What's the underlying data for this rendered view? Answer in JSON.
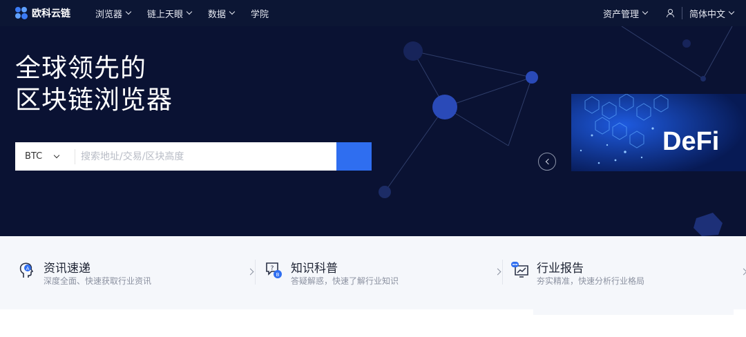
{
  "brand": {
    "name": "欧科云链"
  },
  "nav": {
    "items": [
      {
        "label": "浏览器",
        "has_dropdown": true
      },
      {
        "label": "链上天眼",
        "has_dropdown": true
      },
      {
        "label": "数据",
        "has_dropdown": true
      },
      {
        "label": "学院",
        "has_dropdown": false
      }
    ],
    "asset_label": "资产管理",
    "lang_label": "简体中文"
  },
  "hero": {
    "title_line1": "全球领先的",
    "title_line2": "区块链浏览器",
    "search": {
      "chain_selected": "BTC",
      "placeholder": "搜索地址/交易/区块高度"
    },
    "banner_text": "DeFi"
  },
  "features": [
    {
      "title": "资讯速递",
      "desc": "深度全面、快速获取行业资讯",
      "icon": "news-head-icon"
    },
    {
      "title": "知识科普",
      "desc": "答疑解惑，快速了解行业知识",
      "icon": "knowledge-icon"
    },
    {
      "title": "行业报告",
      "desc": "夯实精准，快速分析行业格局",
      "icon": "report-icon"
    }
  ],
  "colors": {
    "topbar": "#0c1634",
    "hero_bg": "#0a1233",
    "accent": "#2f6ef0",
    "feature_bg": "#f5f7fb"
  }
}
